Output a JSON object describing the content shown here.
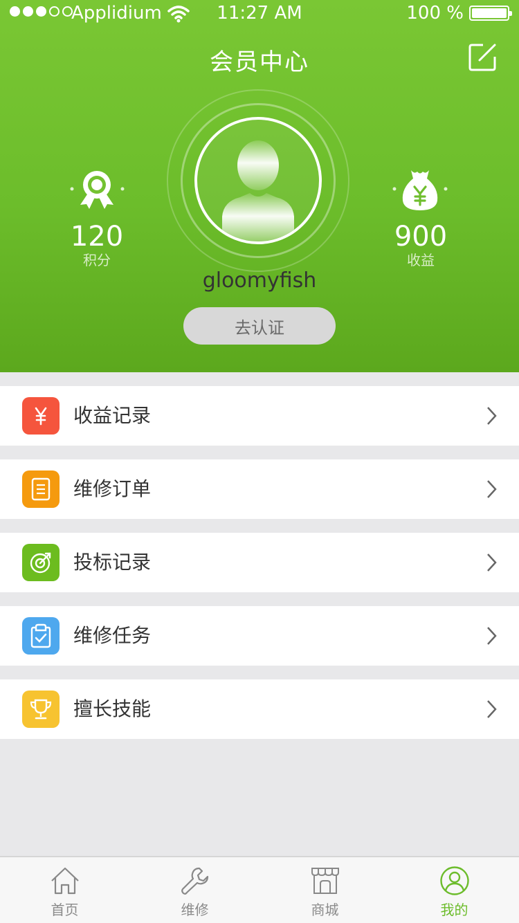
{
  "status_bar": {
    "carrier": "Applidium",
    "time": "11:27 AM",
    "battery": "100 %"
  },
  "header": {
    "title": "会员中心",
    "edit_icon": "edit-icon",
    "username": "gloomyfish",
    "verify_label": "去认证",
    "points": {
      "value": "120",
      "label": "积分",
      "icon": "award-ribbon-icon"
    },
    "earnings": {
      "value": "900",
      "label": "收益",
      "icon": "money-bag-icon"
    }
  },
  "menu": [
    {
      "label": "收益记录",
      "icon": "yen-icon",
      "color": "#f5553d"
    },
    {
      "label": "维修订单",
      "icon": "document-icon",
      "color": "#f59a0e"
    },
    {
      "label": "投标记录",
      "icon": "target-icon",
      "color": "#6cbc1f"
    },
    {
      "label": "维修任务",
      "icon": "clipboard-check-icon",
      "color": "#4ea8ee"
    },
    {
      "label": "擅长技能",
      "icon": "trophy-icon",
      "color": "#f7c330"
    }
  ],
  "tabbar": [
    {
      "label": "首页",
      "icon": "home-icon",
      "active": false
    },
    {
      "label": "维修",
      "icon": "wrench-icon",
      "active": false
    },
    {
      "label": "商城",
      "icon": "store-icon",
      "active": false
    },
    {
      "label": "我的",
      "icon": "user-circle-icon",
      "active": true
    }
  ],
  "colors": {
    "brand_green": "#6cbc2b",
    "background": "#e8e8ea"
  }
}
